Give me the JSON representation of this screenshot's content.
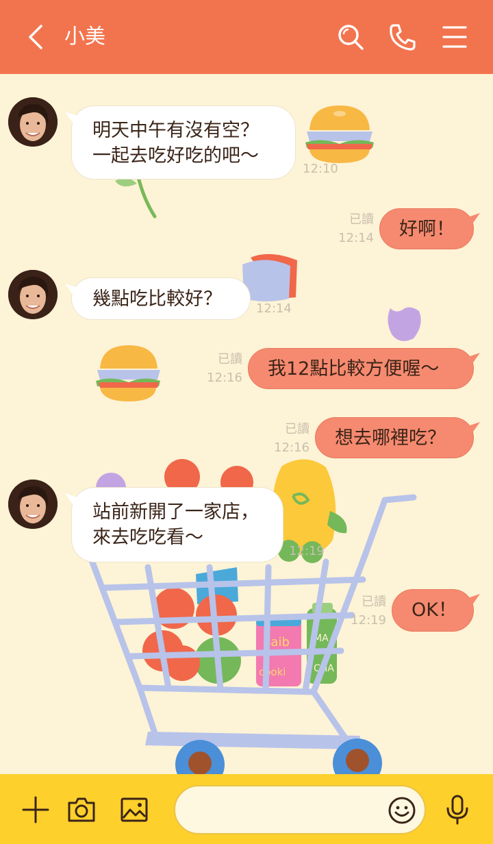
{
  "header": {
    "back_icon": "chevron-left-icon",
    "contact_name": "小美",
    "search_icon": "search-icon",
    "call_icon": "phone-icon",
    "menu_icon": "menu-icon",
    "color": "#f2744e"
  },
  "messages": [
    {
      "side": "in",
      "text": "明天中午有沒有空？\n一起去吃好吃的吧～",
      "time": "12:10"
    },
    {
      "side": "out",
      "text": "好啊！",
      "read": "已讀",
      "time": "12:14"
    },
    {
      "side": "in",
      "text": "幾點吃比較好？",
      "time": "12:14"
    },
    {
      "side": "out",
      "text": "我12點比較方便喔～",
      "read": "已讀",
      "time": "12:16"
    },
    {
      "side": "out",
      "text": "想去哪裡吃？",
      "read": "已讀",
      "time": "12:16"
    },
    {
      "side": "in",
      "text": "站前新開了一家店，\n來去吃吃看～",
      "time": "12:19"
    },
    {
      "side": "out",
      "text": "OK！",
      "read": "已讀",
      "time": "12:19"
    }
  ],
  "footer": {
    "add_icon": "plus-icon",
    "camera_icon": "camera-icon",
    "image_icon": "image-icon",
    "input_value": "",
    "input_placeholder": "",
    "emoji_icon": "emoji-icon",
    "mic_icon": "microphone-icon",
    "color": "#fed02b"
  }
}
